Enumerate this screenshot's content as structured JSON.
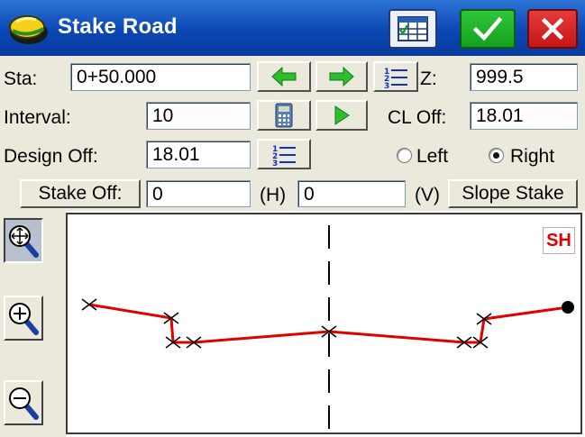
{
  "window": {
    "title": "Stake Road",
    "icon": "road-helmet-icon"
  },
  "toolbar": {
    "grid_icon": "table-icon",
    "ok_icon": "checkmark-icon",
    "cancel_icon": "close-icon"
  },
  "form": {
    "station": {
      "label": "Sta:",
      "value": "0+50.000"
    },
    "interval": {
      "label": "Interval:",
      "value": "10"
    },
    "design_offset": {
      "label": "Design Off:",
      "value": "18.01"
    },
    "z": {
      "label": "Z:",
      "value": "999.5"
    },
    "cl_offset": {
      "label": "CL Off:",
      "value": "18.01"
    },
    "side": {
      "left_label": "Left",
      "right_label": "Right",
      "selected": "Right"
    },
    "stake_offset": {
      "button_label": "Stake Off:",
      "h_value": "0",
      "h_label": "(H)",
      "v_value": "0",
      "v_label": "(V)"
    },
    "slope_stake_label": "Slope Stake"
  },
  "colors": {
    "title_bar": "#0b47b4",
    "panel": "#ebe9dc",
    "arrow_green": "#2ebd2e",
    "profile_line": "#e00000",
    "sh_text": "#e00000"
  },
  "plot": {
    "badge": "SH",
    "zoom_buttons": [
      "zoom-extents-icon",
      "zoom-in-icon",
      "zoom-out-icon"
    ]
  }
}
